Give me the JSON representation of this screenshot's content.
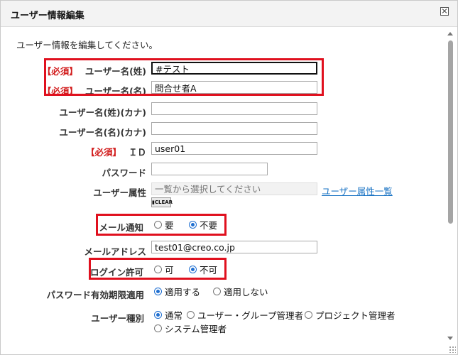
{
  "dialog": {
    "title": "ユーザー情報編集"
  },
  "description": "ユーザー情報を編集してください。",
  "required_tag": "【必須】",
  "fields": {
    "last_name": {
      "label": "ユーザー名(姓)",
      "value": "#テスト"
    },
    "first_name": {
      "label": "ユーザー名(名)",
      "value": "問合せ者A"
    },
    "last_name_kana": {
      "label": "ユーザー名(姓)(カナ)",
      "value": ""
    },
    "first_name_kana": {
      "label": "ユーザー名(名)(カナ)",
      "value": ""
    },
    "id": {
      "label": "ＩＤ",
      "value": "user01"
    },
    "password": {
      "label": "パスワード",
      "value": ""
    },
    "attribute": {
      "label": "ユーザー属性",
      "placeholder": "一覧から選択してください",
      "link": "ユーザー属性一覧",
      "clear": "CLEAR"
    },
    "mail_notify": {
      "label": "メール通知",
      "options": [
        "要",
        "不要"
      ],
      "selected": "不要"
    },
    "email": {
      "label": "メールアドレス",
      "value": "test01@creo.co.jp"
    },
    "login": {
      "label": "ログイン許可",
      "options": [
        "可",
        "不可"
      ],
      "selected": "不可"
    },
    "pw_expiry": {
      "label": "パスワード有効期限適用",
      "options": [
        "適用する",
        "適用しない"
      ],
      "selected": "適用する"
    },
    "user_type": {
      "label": "ユーザー種別",
      "options": [
        "通常",
        "ユーザー・グループ管理者",
        "プロジェクト管理者",
        "システム管理者"
      ],
      "selected": "通常"
    }
  },
  "colors": {
    "required": "#d21e1e",
    "highlight": "#e0101e",
    "link": "#1b74c4",
    "radio": "#1f6fd1"
  },
  "icons": [
    "close-icon",
    "clear-icon",
    "scroll-up-icon",
    "scroll-down-icon",
    "resize-grip-icon"
  ]
}
